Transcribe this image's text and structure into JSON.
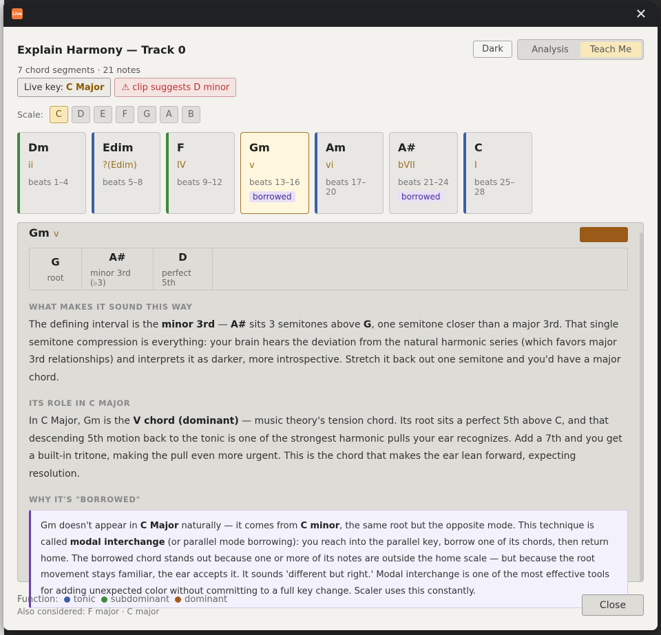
{
  "window": {
    "app_icon_text": "Live",
    "close_glyph": "✕"
  },
  "header": {
    "title": "Explain Harmony — Track 0",
    "subtitle": "7 chord segments · 21 notes",
    "theme_button": "Dark",
    "modes": [
      {
        "label": "Analysis",
        "active": false
      },
      {
        "label": "Teach Me",
        "active": true
      }
    ]
  },
  "badges": {
    "live_key_label": "Live key:",
    "live_key_value": "C Major",
    "warning": "⚠ clip suggests D minor"
  },
  "scale": {
    "label": "Scale:",
    "notes": [
      "C",
      "D",
      "E",
      "F",
      "G",
      "A",
      "B"
    ],
    "selected": "C"
  },
  "chords": [
    {
      "name": "Dm",
      "roman": "ii",
      "beats": "beats 1–4",
      "tag": "",
      "function": "subdom"
    },
    {
      "name": "Edim",
      "roman": "?(Edim)",
      "beats": "beats 5–8",
      "tag": "",
      "function": "tonic"
    },
    {
      "name": "F",
      "roman": "IV",
      "beats": "beats 9–12",
      "tag": "",
      "function": "subdom"
    },
    {
      "name": "Gm",
      "roman": "v",
      "beats": "beats 13–16",
      "tag": "borrowed",
      "function": "dom",
      "selected": true
    },
    {
      "name": "Am",
      "roman": "vi",
      "beats": "beats 17–20",
      "tag": "",
      "function": "tonic"
    },
    {
      "name": "A#",
      "roman": "bVII",
      "beats": "beats 21–24",
      "tag": "borrowed",
      "function": "none"
    },
    {
      "name": "C",
      "roman": "I",
      "beats": "beats 25–28",
      "tag": "",
      "function": "tonic"
    }
  ],
  "detail": {
    "name": "Gm",
    "roman": "v",
    "swatch_color": "#9a5a18",
    "intervals": [
      {
        "note": "G",
        "role": "root"
      },
      {
        "note": "A#",
        "role": "minor 3rd (♭3)"
      },
      {
        "note": "D",
        "role": "perfect 5th"
      }
    ],
    "sections": {
      "sound_heading": "WHAT MAKES IT SOUND THIS WAY",
      "sound_p1": "The defining interval is the ",
      "sound_b1": "minor 3rd",
      "sound_p2": " — ",
      "sound_b2": "A#",
      "sound_p3": " sits 3 semitones above ",
      "sound_b3": "G",
      "sound_p4": ", one semitone closer than a major 3rd. That single semitone compression is everything: your brain hears the deviation from the natural harmonic series (which favors major 3rd relationships) and interprets it as darker, more introspective. Stretch it back out one semitone and you'd have a major chord.",
      "role_heading": "ITS ROLE IN C MAJOR",
      "role_p1": "In C Major, Gm is the ",
      "role_b1": "V chord (dominant)",
      "role_p2": " — music theory's tension chord. Its root sits a perfect 5th above C, and that descending 5th motion back to the tonic is one of the strongest harmonic pulls your ear recognizes. Add a 7th and you get a built-in tritone, making the pull even more urgent. This is the chord that makes the ear lean forward, expecting resolution.",
      "borrow_heading": "WHY IT'S \"BORROWED\"",
      "borrow_p1": "Gm doesn't appear in ",
      "borrow_b1": "C Major",
      "borrow_p2": " naturally — it comes from ",
      "borrow_b2": "C minor",
      "borrow_p3": ", the same root but the opposite mode. This technique is called ",
      "borrow_b3": "modal interchange",
      "borrow_p4": " (or parallel mode borrowing): you reach into the parallel key, borrow one of its chords, then return home. The borrowed chord stands out because one or more of its notes are outside the home scale — but because the root movement stays familiar, the ear accepts it. It sounds 'different but right.' Modal interchange is one of the most effective tools for adding unexpected color without committing to a full key change. Scaler uses this constantly."
    }
  },
  "footer": {
    "function_label": "Function:",
    "legend": [
      {
        "label": "tonic",
        "color": "#3b5fa6"
      },
      {
        "label": "subdominant",
        "color": "#3d8a3d"
      },
      {
        "label": "dominant",
        "color": "#a35a16"
      }
    ],
    "also_considered": "Also considered: F major · C major",
    "close_label": "Close"
  }
}
